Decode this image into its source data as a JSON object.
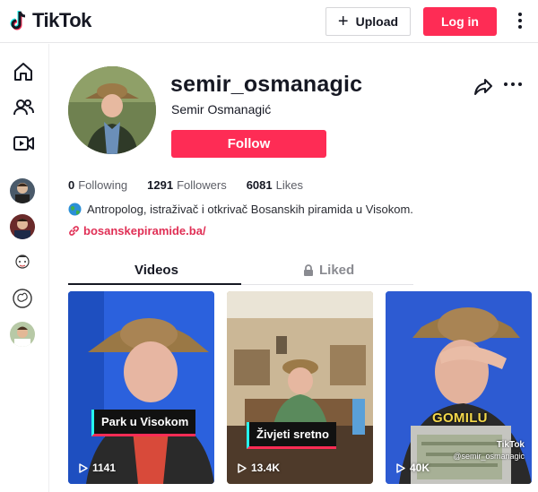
{
  "header": {
    "logo_text": "TikTok",
    "upload_label": "Upload",
    "login_label": "Log in"
  },
  "sidebar": {
    "icons": [
      "home-icon",
      "following-icon",
      "live-icon"
    ],
    "accounts": [
      "account-1",
      "account-2",
      "account-3",
      "account-4",
      "account-5"
    ]
  },
  "profile": {
    "username": "semir_osmanagic",
    "full_name": "Semir Osmanagić",
    "follow_label": "Follow",
    "stats": {
      "following_count": "0",
      "following_label": "Following",
      "followers_count": "1291",
      "followers_label": "Followers",
      "likes_count": "6081",
      "likes_label": "Likes"
    },
    "bio": "Antropolog, istraživač i otkrivač Bosanskih piramida u Visokom.",
    "link": "bosanskepiramide.ba/"
  },
  "tabs": {
    "videos": "Videos",
    "liked": "Liked"
  },
  "videos": [
    {
      "caption": "Park u Visokom",
      "views": "1141"
    },
    {
      "caption": "Živjeti sretno",
      "views": "13.4K"
    },
    {
      "caption": "GOMILU",
      "views": "40K",
      "watermark_brand": "TikTok",
      "watermark_user": "@semir_osmanagic"
    }
  ],
  "colors": {
    "accent": "#fe2c55",
    "link": "#e02f55",
    "text": "#161823",
    "muted": "#8a8b91"
  }
}
